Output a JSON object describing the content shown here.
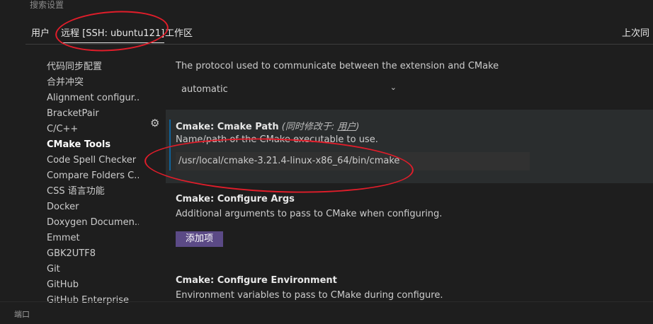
{
  "header": {
    "search_label": "搜索设置"
  },
  "tabs": {
    "user": "用户",
    "remote": "远程 [SSH: ubuntu121]",
    "workspace": "工作区",
    "last_synced": "上次同"
  },
  "sidebar": {
    "items": [
      {
        "label": "代码同步配置"
      },
      {
        "label": "合并冲突"
      },
      {
        "label": "Alignment configur..."
      },
      {
        "label": "BracketPair"
      },
      {
        "label": "C/C++"
      },
      {
        "label": "CMake Tools"
      },
      {
        "label": "Code Spell Checker"
      },
      {
        "label": "Compare Folders C..."
      },
      {
        "label": "CSS 语言功能"
      },
      {
        "label": "Docker"
      },
      {
        "label": "Doxygen Documen..."
      },
      {
        "label": "Emmet"
      },
      {
        "label": "GBK2UTF8"
      },
      {
        "label": "Git"
      },
      {
        "label": "GitHub"
      },
      {
        "label": "GitHub Enterprise"
      }
    ]
  },
  "settings": {
    "protocol": {
      "description": "The protocol used to communicate between the extension and CMake",
      "value": "automatic"
    },
    "cmake_path": {
      "title": "Cmake: Cmake Path",
      "modified_prefix": "(同时修改于: ",
      "modified_link": "用户",
      "modified_suffix": ")",
      "description": "Name/path of the CMake executable to use.",
      "value": "/usr/local/cmake-3.21.4-linux-x86_64/bin/cmake"
    },
    "configure_args": {
      "title": "Cmake: Configure Args",
      "description": "Additional arguments to pass to CMake when configuring.",
      "add_button": "添加项"
    },
    "configure_env": {
      "title": "Cmake: Configure Environment",
      "description": "Environment variables to pass to CMake during configure."
    }
  },
  "statusbar": {
    "label": "端口"
  }
}
